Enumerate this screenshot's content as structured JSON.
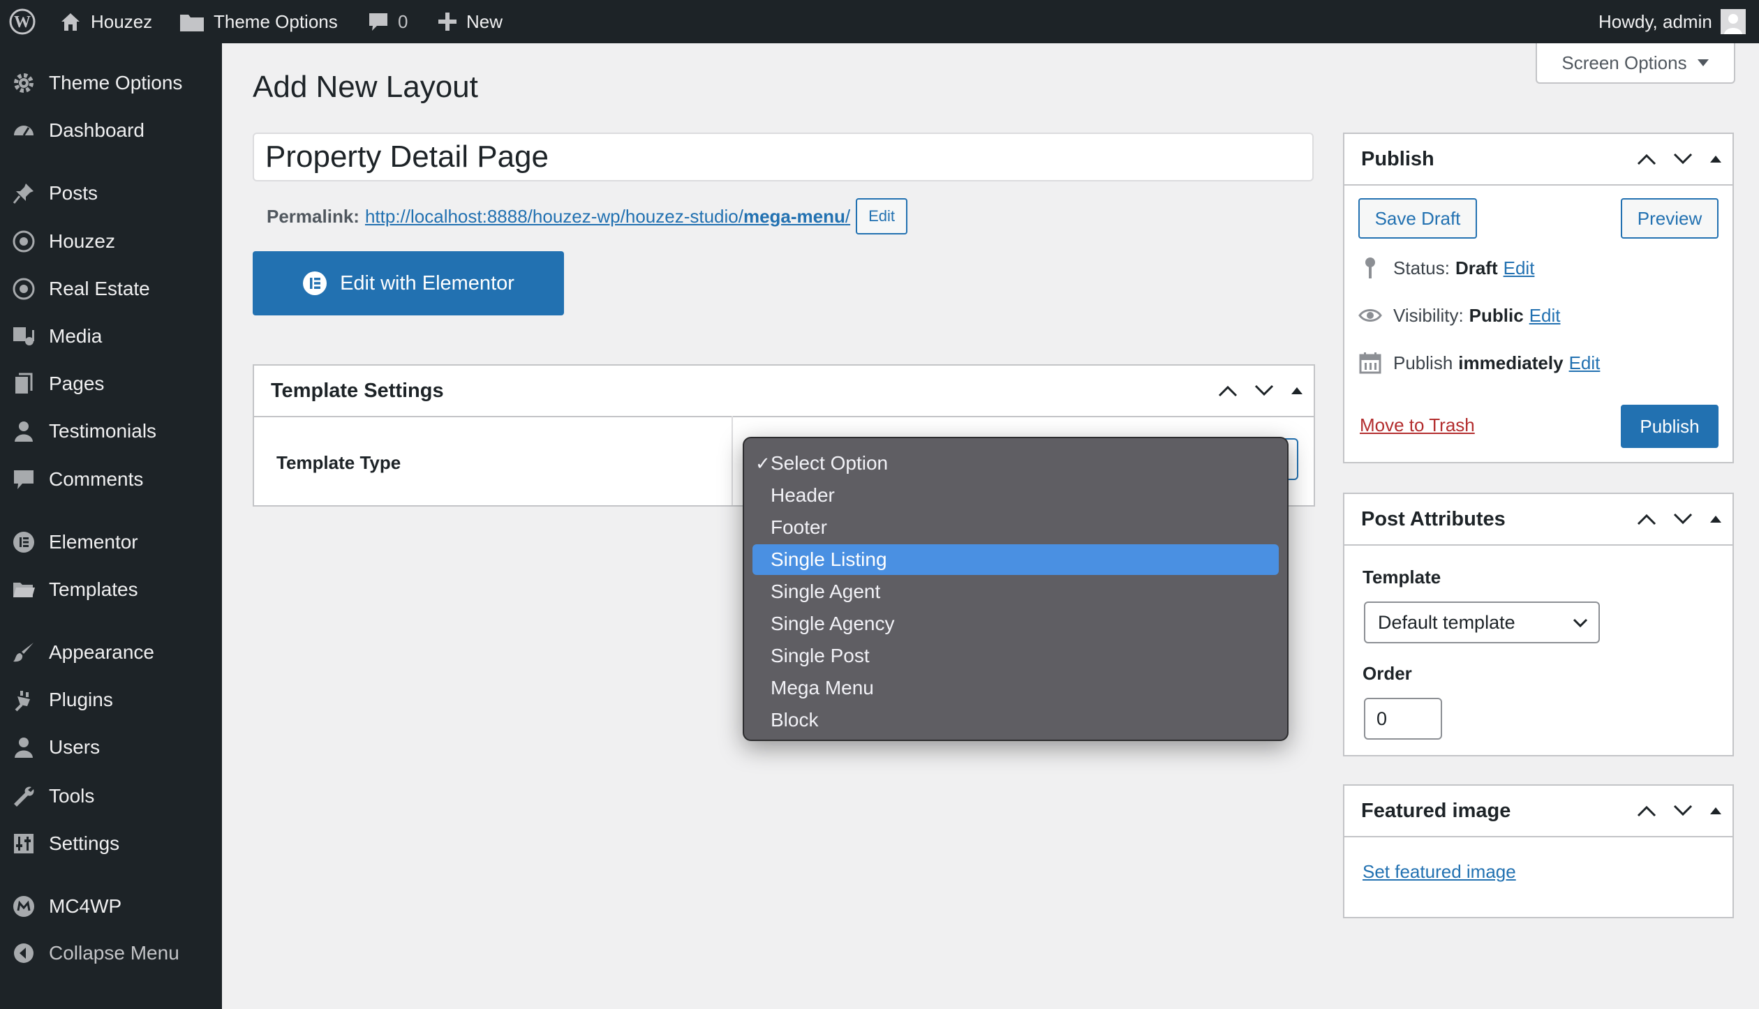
{
  "adminbar": {
    "site_name": "Houzez",
    "theme_options": "Theme Options",
    "comments_count": "0",
    "new_label": "New",
    "howdy": "Howdy, admin"
  },
  "sidebar": {
    "items": [
      {
        "label": "Theme Options",
        "icon": "gear-icon"
      },
      {
        "label": "Dashboard",
        "icon": "dashboard-icon"
      },
      {
        "label": "Posts",
        "icon": "pin-icon"
      },
      {
        "label": "Houzez",
        "icon": "target-icon"
      },
      {
        "label": "Real Estate",
        "icon": "target-icon"
      },
      {
        "label": "Media",
        "icon": "media-icon"
      },
      {
        "label": "Pages",
        "icon": "pages-icon"
      },
      {
        "label": "Testimonials",
        "icon": "user-icon"
      },
      {
        "label": "Comments",
        "icon": "comment-icon"
      },
      {
        "label": "Elementor",
        "icon": "elementor-icon"
      },
      {
        "label": "Templates",
        "icon": "folder-icon"
      },
      {
        "label": "Appearance",
        "icon": "brush-icon"
      },
      {
        "label": "Plugins",
        "icon": "plug-icon"
      },
      {
        "label": "Users",
        "icon": "user-icon"
      },
      {
        "label": "Tools",
        "icon": "wrench-icon"
      },
      {
        "label": "Settings",
        "icon": "settings-icon"
      },
      {
        "label": "MC4WP",
        "icon": "mc4wp-icon"
      },
      {
        "label": "Collapse Menu",
        "icon": "collapse-icon"
      }
    ]
  },
  "main": {
    "page_title": "Add New Layout",
    "screen_options": "Screen Options",
    "title_value": "Property Detail Page",
    "permalink": {
      "label": "Permalink:",
      "url_base": "http://localhost:8888/houzez-wp/houzez-studio/",
      "slug": "mega-menu",
      "trailing": "/",
      "edit": "Edit"
    },
    "elementor_button": "Edit with Elementor",
    "template_settings": {
      "title": "Template Settings",
      "field_label": "Template Type",
      "options": [
        "Select Option",
        "Header",
        "Footer",
        "Single Listing",
        "Single Agent",
        "Single Agency",
        "Single Post",
        "Mega Menu",
        "Block"
      ],
      "checked": "Select Option",
      "highlighted": "Single Listing"
    }
  },
  "publish": {
    "title": "Publish",
    "save_draft": "Save Draft",
    "preview": "Preview",
    "status_label": "Status:",
    "status_value": "Draft",
    "visibility_label": "Visibility:",
    "visibility_value": "Public",
    "publish_label": "Publish",
    "publish_value": "immediately",
    "edit": "Edit",
    "move_to_trash": "Move to Trash",
    "publish_button": "Publish"
  },
  "attributes": {
    "title": "Post Attributes",
    "template_label": "Template",
    "template_value": "Default template",
    "order_label": "Order",
    "order_value": "0"
  },
  "featured": {
    "title": "Featured image",
    "link": "Set featured image"
  },
  "colors": {
    "admin_dark": "#1d2327",
    "accent": "#2271b1",
    "trash": "#b32d2e",
    "dropdown_bg": "#5f5e63",
    "dropdown_highlight": "#4a90e2"
  }
}
